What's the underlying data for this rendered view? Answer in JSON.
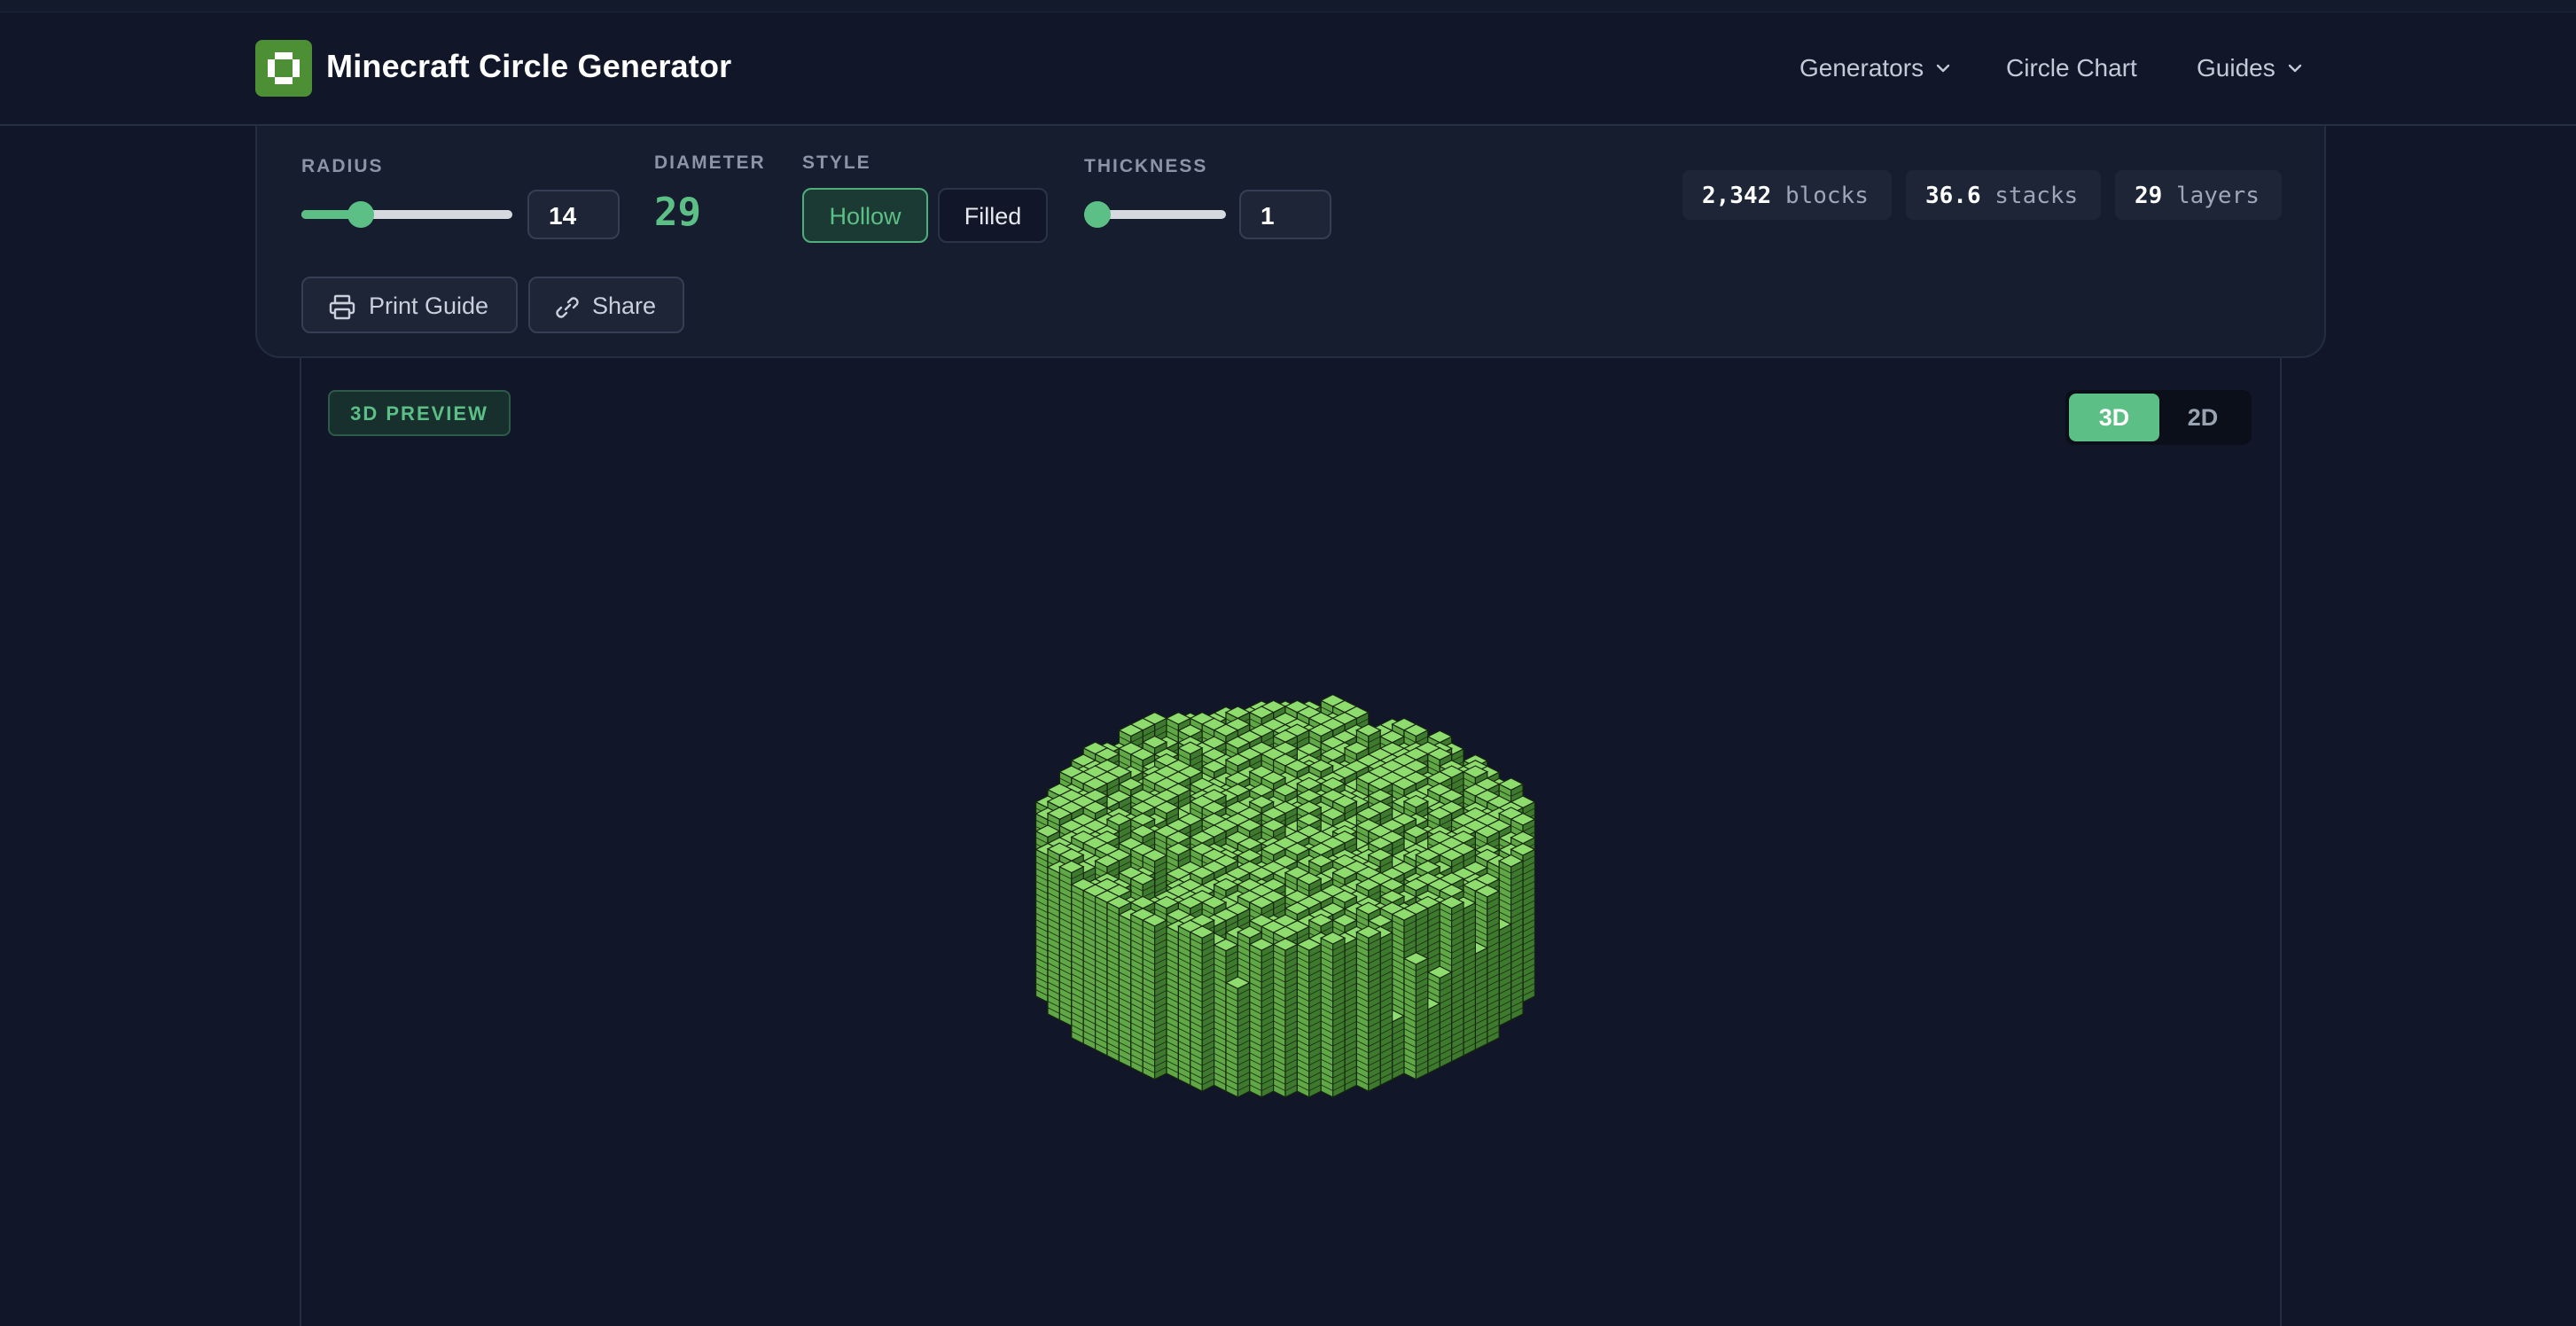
{
  "header": {
    "brand": "Minecraft Circle Generator",
    "logo_icon": "circle-block-icon",
    "nav": [
      {
        "label": "Generators",
        "dropdown": true
      },
      {
        "label": "Circle Chart",
        "dropdown": false
      },
      {
        "label": "Guides",
        "dropdown": true
      }
    ]
  },
  "controls": {
    "radius": {
      "label": "RADIUS",
      "value": "14",
      "slider_fraction": 0.28
    },
    "diameter": {
      "label": "DIAMETER",
      "value": "29"
    },
    "style": {
      "label": "STYLE",
      "options": [
        "Hollow",
        "Filled"
      ],
      "selected": "Hollow"
    },
    "thickness": {
      "label": "THICKNESS",
      "value": "1",
      "slider_fraction": 0.0
    },
    "print_label": "Print Guide",
    "share_label": "Share"
  },
  "stats": [
    {
      "value": "2,342",
      "unit": "blocks"
    },
    {
      "value": "36.6",
      "unit": "stacks"
    },
    {
      "value": "29",
      "unit": "layers"
    }
  ],
  "preview": {
    "tag": "3D PREVIEW",
    "modes": [
      "3D",
      "2D"
    ],
    "active_mode": "3D"
  },
  "colors": {
    "accent": "#5cbf85",
    "block_top": "#8fdc6e",
    "block_left": "#5fa845",
    "block_right": "#3e7a2e",
    "background": "#111729"
  }
}
